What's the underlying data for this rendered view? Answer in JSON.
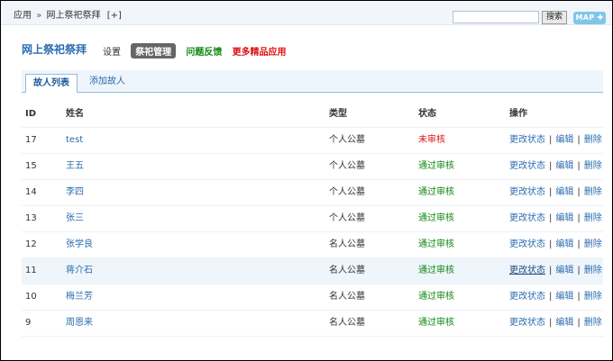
{
  "topbar": {
    "crumb_root": "应用",
    "crumb_sep": "»",
    "crumb_current": "网上祭祀祭拜",
    "crumb_add": "[+]",
    "search_placeholder": "",
    "search_button": "搜索",
    "map_button": "MAP ✚"
  },
  "header": {
    "app_title": "网上祭祀祭拜",
    "nav": {
      "settings": "设置",
      "manage": "祭祀管理",
      "feedback": "问题反馈",
      "more": "更多精品应用"
    }
  },
  "tabs": {
    "list": "故人列表",
    "add": "添加故人"
  },
  "table": {
    "headers": {
      "id": "ID",
      "name": "姓名",
      "type": "类型",
      "status": "状态",
      "ops": "操作"
    },
    "op_labels": {
      "change": "更改状态",
      "edit": "编辑",
      "delete": "删除",
      "sep": "|"
    },
    "rows": [
      {
        "id": "17",
        "name": "test",
        "type": "个人公墓",
        "status": "未审核"
      },
      {
        "id": "15",
        "name": "王五",
        "type": "个人公墓",
        "status": "通过审核"
      },
      {
        "id": "14",
        "name": "李四",
        "type": "个人公墓",
        "status": "通过审核"
      },
      {
        "id": "13",
        "name": "张三",
        "type": "个人公墓",
        "status": "通过审核"
      },
      {
        "id": "12",
        "name": "张学良",
        "type": "名人公墓",
        "status": "通过审核"
      },
      {
        "id": "11",
        "name": "蒋介石",
        "type": "名人公墓",
        "status": "通过审核"
      },
      {
        "id": "10",
        "name": "梅兰芳",
        "type": "名人公墓",
        "status": "通过审核"
      },
      {
        "id": "9",
        "name": "周恩来",
        "type": "名人公墓",
        "status": "通过审核"
      }
    ]
  },
  "colors": {
    "link": "#2b6cb0",
    "pending": "#dd1111",
    "passed": "#118811",
    "highlight_row": "#eef5fb"
  }
}
